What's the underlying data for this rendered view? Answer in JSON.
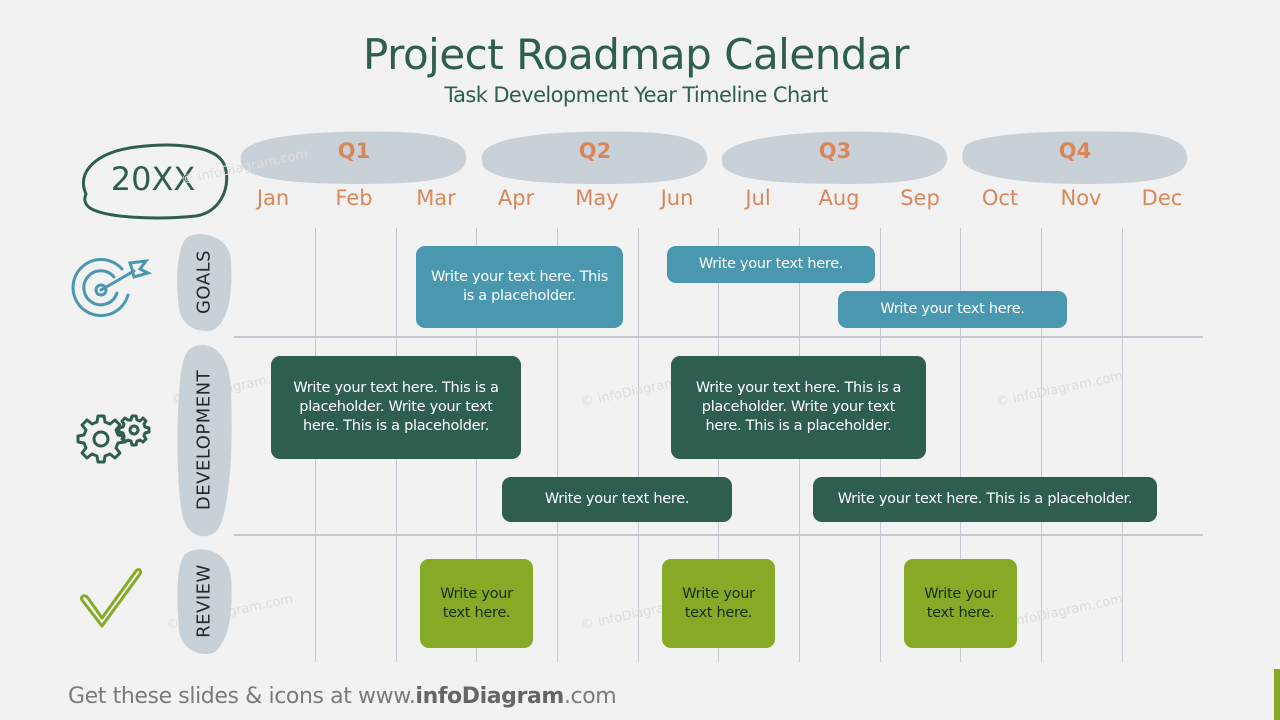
{
  "header": {
    "title": "Project Roadmap Calendar",
    "subtitle": "Task Development Year Timeline Chart"
  },
  "year": "20XX",
  "quarters": [
    {
      "label": "Q1",
      "months": [
        "Jan",
        "Feb",
        "Mar"
      ]
    },
    {
      "label": "Q2",
      "months": [
        "Apr",
        "May",
        "Jun"
      ]
    },
    {
      "label": "Q3",
      "months": [
        "Jul",
        "Aug",
        "Sep"
      ]
    },
    {
      "label": "Q4",
      "months": [
        "Oct",
        "Nov",
        "Dec"
      ]
    }
  ],
  "months": [
    "Jan",
    "Feb",
    "Mar",
    "Apr",
    "May",
    "Jun",
    "Jul",
    "Aug",
    "Sep",
    "Oct",
    "Nov",
    "Dec"
  ],
  "rows": [
    {
      "id": "goals",
      "label": "GOALS",
      "icon": "target-icon"
    },
    {
      "id": "development",
      "label": "DEVELOPMENT",
      "icon": "gears-icon"
    },
    {
      "id": "review",
      "label": "REVIEW",
      "icon": "checkmark-icon"
    }
  ],
  "tasks": {
    "goals": [
      {
        "text": "Write your text here. This is a placeholder.",
        "start_month": "Mar",
        "end_month": "May"
      },
      {
        "text": "Write your text here.",
        "start_month": "Jun",
        "end_month": "Aug"
      },
      {
        "text": "Write your text here.",
        "start_month": "Aug",
        "end_month": "Nov"
      }
    ],
    "development": [
      {
        "text": "Write your text here. This is a placeholder.  Write your text here. This is a placeholder.",
        "start_month": "Jan",
        "end_month": "Apr"
      },
      {
        "text": "Write your text here. This is a placeholder.  Write your text here. This is a placeholder.",
        "start_month": "Jun",
        "end_month": "Sep"
      },
      {
        "text": "Write your text here.",
        "start_month": "Apr",
        "end_month": "Jun"
      },
      {
        "text": "Write your text here. This is a placeholder.",
        "start_month": "Aug",
        "end_month": "Dec"
      }
    ],
    "review": [
      {
        "text": "Write your text here.",
        "month": "Mar"
      },
      {
        "text": "Write your text here.",
        "month": "Jun"
      },
      {
        "text": "Write your text here.",
        "month": "Sep"
      }
    ]
  },
  "watermark": "© infoDiagram.com",
  "footer": {
    "prefix": "Get these slides & icons at www.",
    "brand": "infoDiagram",
    "suffix": ".com"
  },
  "colors": {
    "title": "#2e5e50",
    "month_text": "#d9875a",
    "quarter_blob": "#c9d1d8",
    "goals": "#4a97b0",
    "development": "#2e5e50",
    "review": "#86aa25",
    "gridline": "#c3cad2"
  }
}
